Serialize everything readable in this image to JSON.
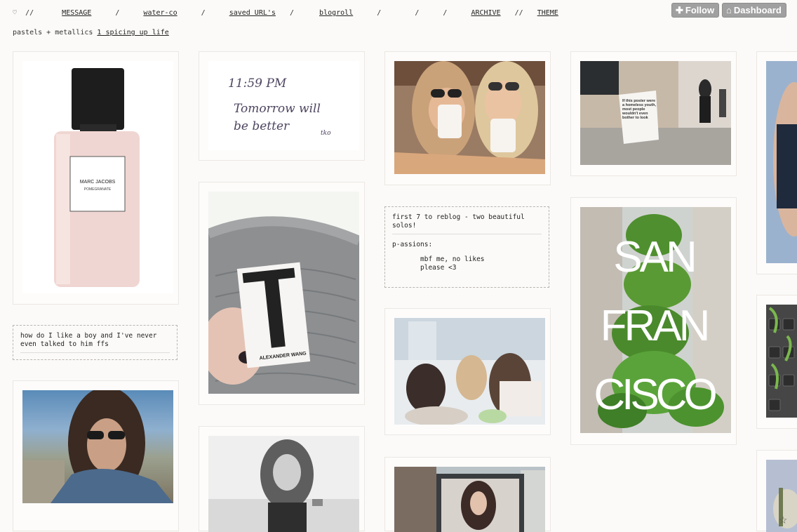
{
  "nav": {
    "heart": "♡",
    "sep0": "//",
    "message": "MESSAGE",
    "sep1": "/",
    "waterco": "water-co",
    "sep2": "/",
    "saved": "saved URL's",
    "sep3": "/",
    "blogroll": "blogroll",
    "sep4": "/",
    "sep5": "/",
    "sep6": "/",
    "archive": "ARCHIVE",
    "sep7": "//",
    "theme": "THEME"
  },
  "subtitle": {
    "prefix": "pastels + metallics",
    "link": "1 spicing up life"
  },
  "toolbar": {
    "follow": "Follow",
    "dashboard": "Dashboard"
  },
  "posts": {
    "perfume_brand": "MARC JACOBS",
    "perfume_name": "POMEGRANATE",
    "note_time": "11:59 PM",
    "note_line1": "Tomorrow will",
    "note_line2": "be better",
    "note_sig": "tko",
    "tag_brand": "ALEXANDER WANG",
    "sf_line1": "SAN",
    "sf_line2": "FRAN",
    "sf_line3": "CISCO",
    "poster_text": "If this poster were a homeless youth, most people wouldn't even bother to look",
    "text_boy": "how do I like a boy and I've never even talked to him ffs",
    "text_first7": "first 7 to reblog - two beautiful solos!",
    "text_passions": "p-assions:",
    "text_mbf1": "mbf me, no likes",
    "text_mbf2": "please <3"
  },
  "colors": {
    "background": "#fbfaf8",
    "toolbar_button": "#a0a0a0",
    "dashed_border": "#b9b4b0"
  }
}
